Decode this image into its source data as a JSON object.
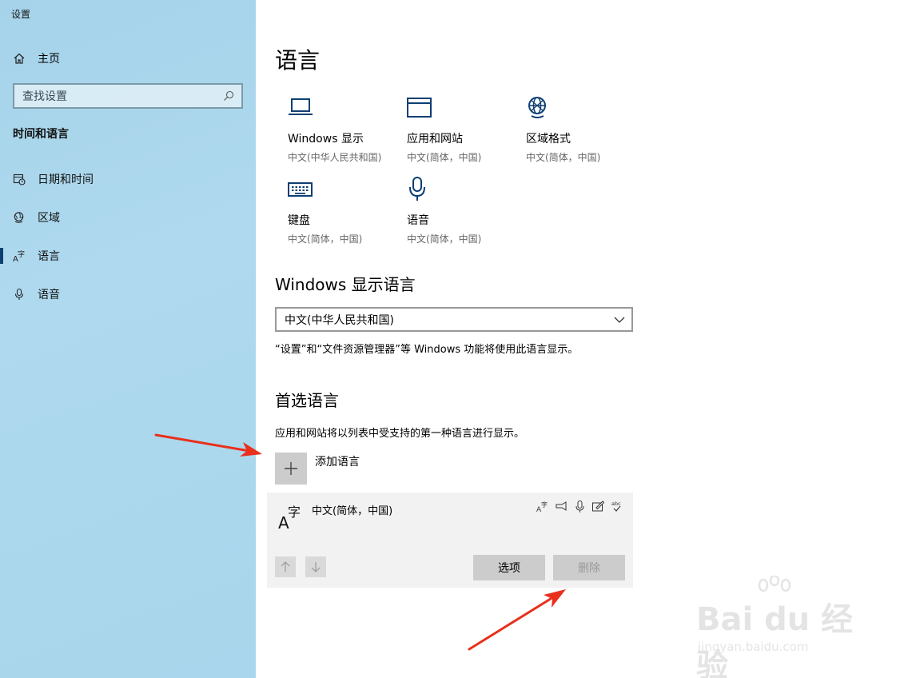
{
  "window": {
    "title": "设置"
  },
  "sidebar": {
    "home_label": "主页",
    "search_placeholder": "查找设置",
    "section_title": "时间和语言",
    "items": [
      {
        "label": "日期和时间",
        "icon": "calendar-clock-icon"
      },
      {
        "label": "区域",
        "icon": "globe-region-icon"
      },
      {
        "label": "语言",
        "icon": "language-icon",
        "active": true
      },
      {
        "label": "语音",
        "icon": "microphone-icon"
      }
    ]
  },
  "main": {
    "title": "语言",
    "tiles": [
      {
        "name": "Windows 显示",
        "sub": "中文(中华人民共和国)",
        "icon": "monitor-icon"
      },
      {
        "name": "应用和网站",
        "sub": "中文(简体，中国)",
        "icon": "browser-window-icon"
      },
      {
        "name": "区域格式",
        "sub": "中文(简体，中国)",
        "icon": "globe-format-icon"
      },
      {
        "name": "键盘",
        "sub": "中文(简体，中国)",
        "icon": "keyboard-icon"
      },
      {
        "name": "语音",
        "sub": "中文(简体，中国)",
        "icon": "microphone-icon"
      }
    ],
    "display_language": {
      "heading": "Windows 显示语言",
      "selected": "中文(中华人民共和国)",
      "note": "“设置”和“文件资源管理器”等 Windows 功能将使用此语言显示。"
    },
    "preferred": {
      "heading": "首选语言",
      "note": "应用和网站将以列表中受支持的第一种语言进行显示。",
      "add_label": "添加语言",
      "language_name": "中文(简体，中国)",
      "options_label": "选项",
      "remove_label": "删除"
    }
  },
  "watermark": {
    "brand": "Bai du 经验",
    "url": "jingyan.baidu.com"
  },
  "colors": {
    "accent": "#0d3f73",
    "sidebar_bg": "#a9d6ec",
    "arrow": "#e8301c"
  }
}
